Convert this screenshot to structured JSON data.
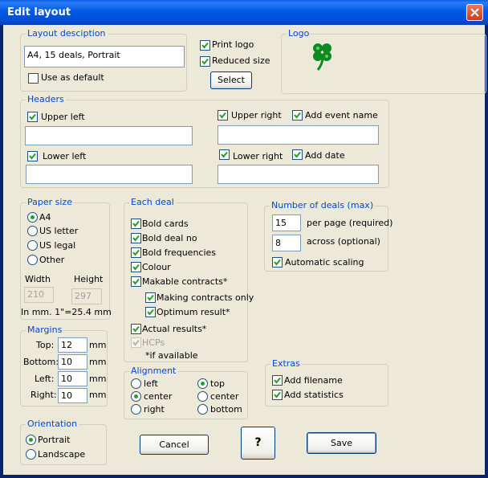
{
  "window": {
    "title": "Edit layout"
  },
  "layout_description": {
    "legend": "Layout desciption",
    "value": "A4, 15 deals, Portrait",
    "use_as_default_label": "Use as default",
    "use_as_default_checked": false
  },
  "logo_options": {
    "print_logo_label": "Print logo",
    "print_logo_checked": true,
    "reduced_size_label": "Reduced size",
    "reduced_size_checked": true,
    "select_button": "Select"
  },
  "logo": {
    "legend": "Logo",
    "icon": "clover-icon"
  },
  "headers": {
    "legend": "Headers",
    "upper_left_label": "Upper left",
    "upper_left_checked": true,
    "upper_left_value": "",
    "lower_left_label": "Lower left",
    "lower_left_checked": true,
    "lower_left_value": "",
    "upper_right_label": "Upper right",
    "upper_right_checked": true,
    "upper_right_value": "",
    "lower_right_label": "Lower right",
    "lower_right_checked": true,
    "lower_right_value": "",
    "add_event_name_label": "Add event name",
    "add_event_name_checked": true,
    "add_date_label": "Add date",
    "add_date_checked": true
  },
  "paper_size": {
    "legend": "Paper size",
    "options": [
      "A4",
      "US letter",
      "US legal",
      "Other"
    ],
    "selected": "A4",
    "width_label": "Width",
    "height_label": "Height",
    "width_value": "210",
    "height_value": "297",
    "note": "In mm. 1\"=25.4 mm"
  },
  "margins": {
    "legend": "Margins",
    "top_label": "Top:",
    "top_value": "12",
    "bottom_label": "Bottom:",
    "bottom_value": "10",
    "left_label": "Left:",
    "left_value": "10",
    "right_label": "Right:",
    "right_value": "10",
    "unit": "mm"
  },
  "orientation": {
    "legend": "Orientation",
    "options": [
      "Portrait",
      "Landscape"
    ],
    "selected": "Portrait"
  },
  "each_deal": {
    "legend": "Each deal",
    "bold_cards": "Bold cards",
    "bold_deal_no": "Bold deal no",
    "bold_frequencies": "Bold frequencies",
    "colour": "Colour",
    "makable_contracts": "Makable contracts*",
    "making_contracts_only": "Making contracts only",
    "optimum_result": "Optimum result*",
    "actual_results": "Actual results*",
    "hcps": "HCPs",
    "hcps_checked": true,
    "hcps_enabled": false,
    "footnote": "*if available"
  },
  "alignment": {
    "legend": "Alignment",
    "horizontal_options": [
      "left",
      "center",
      "right"
    ],
    "horizontal_selected": "center",
    "vertical_options": [
      "top",
      "center",
      "bottom"
    ],
    "vertical_selected": "top"
  },
  "number_of_deals": {
    "legend": "Number of deals (max)",
    "per_page_value": "15",
    "per_page_label": "per page (required)",
    "across_value": "8",
    "across_label": "across (optional)",
    "automatic_scaling_label": "Automatic scaling",
    "automatic_scaling_checked": true
  },
  "extras": {
    "legend": "Extras",
    "add_filename_label": "Add filename",
    "add_filename_checked": true,
    "add_statistics_label": "Add statistics",
    "add_statistics_checked": true
  },
  "buttons": {
    "cancel": "Cancel",
    "help": "?",
    "save": "Save"
  },
  "colors": {
    "title_bar": "#0058e6",
    "dialog_bg": "#ece9d8",
    "legend_text": "#0046d5",
    "check_mark": "#21a121",
    "radio_dot": "#21a121"
  }
}
